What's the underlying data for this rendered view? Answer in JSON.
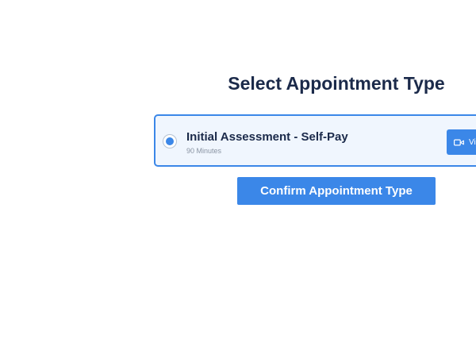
{
  "page": {
    "title": "Select Appointment Type"
  },
  "appointment_option": {
    "name": "Initial Assessment - Self-Pay",
    "duration": "90 Minutes",
    "selected": true,
    "badge_label": "Vi",
    "badge_icon": "video-camera-icon"
  },
  "confirm_button": {
    "label": "Confirm Appointment Type"
  },
  "colors": {
    "accent": "#3b87e8",
    "title_text": "#1b2a4a",
    "card_background": "#f0f6fe",
    "muted_text": "#8a94a3"
  }
}
